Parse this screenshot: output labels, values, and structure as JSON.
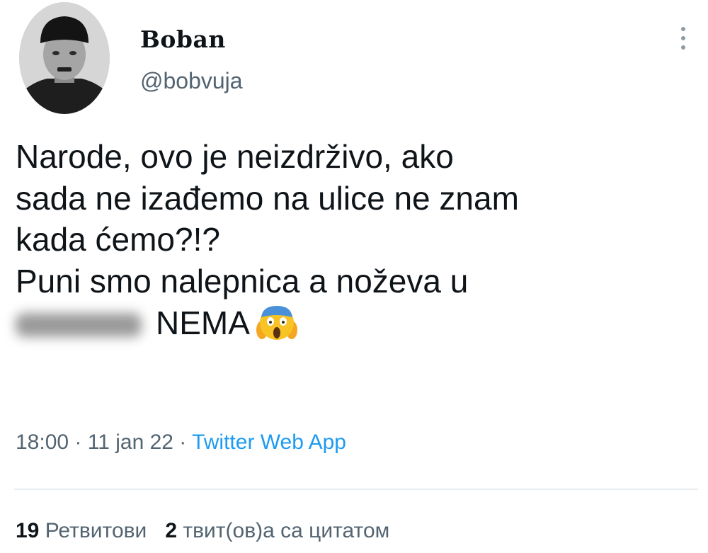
{
  "author": {
    "display_name": "Boban",
    "handle": "@bobvuja"
  },
  "tweet": {
    "lines": [
      "Narode, ovo je neizdrživo, ako",
      "sada ne izađemo na ulice ne znam",
      "kada ćemo?!?",
      "Puni smo nalepnica a noževa u"
    ],
    "last_line_text": "NEMA",
    "emoji": "screaming-in-fear-emoji"
  },
  "meta": {
    "time": "18:00",
    "separator": " · ",
    "date": "11 jan 22",
    "source": "Twitter Web App"
  },
  "stats": {
    "retweets_count": "19",
    "retweets_label": "Ретвитови",
    "quotes_count": "2",
    "quotes_label": "твит(ов)а са цитатом"
  },
  "colors": {
    "text": "#0f1419",
    "secondary": "#536471",
    "link": "#1d9bf0"
  }
}
